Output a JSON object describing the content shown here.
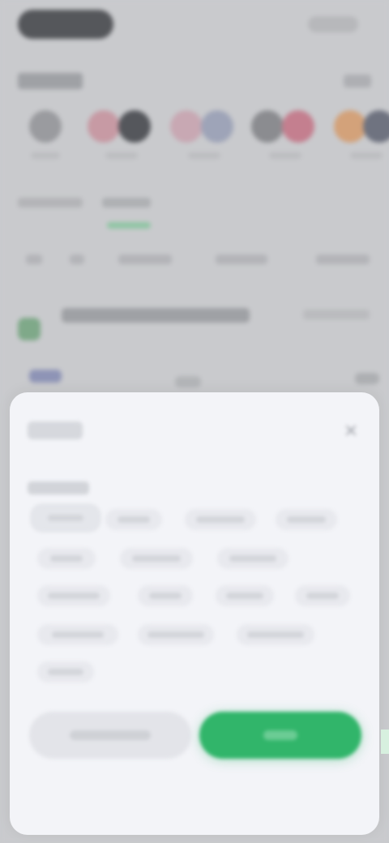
{
  "colors": {
    "backdrop": "#c9cacd",
    "sheet": "#f3f4f8",
    "accent": "#31b56a",
    "accent_soft": "#8fc5a3",
    "chip": "#e8e9ee"
  },
  "background": {
    "avatar_groups": [
      {
        "colors": [
          "#9a9b9f"
        ]
      },
      {
        "colors": [
          "#c79aa4",
          "#55575c"
        ]
      },
      {
        "colors": [
          "#c8a8b3",
          "#9ea4b8"
        ]
      },
      {
        "colors": [
          "#8b8c90",
          "#c47f8f"
        ]
      },
      {
        "colors": [
          "#d3a27a",
          "#6f7380"
        ]
      }
    ],
    "icons": {
      "list_icon": "leaf-icon"
    }
  },
  "sheet": {
    "title": "",
    "close_icon": "close-icon",
    "chip_rows": [
      [
        {
          "selected": true
        },
        {
          "selected": false
        },
        {
          "selected": false
        },
        {
          "selected": false
        }
      ],
      [
        {
          "selected": false
        },
        {
          "selected": false
        },
        {
          "selected": false
        }
      ],
      [
        {
          "selected": false
        },
        {
          "selected": false
        },
        {
          "selected": false
        },
        {
          "selected": false
        }
      ],
      [
        {
          "selected": false
        },
        {
          "selected": false
        },
        {
          "selected": false
        }
      ],
      [
        {
          "selected": false
        }
      ]
    ],
    "reset_label": "",
    "confirm_label": ""
  }
}
